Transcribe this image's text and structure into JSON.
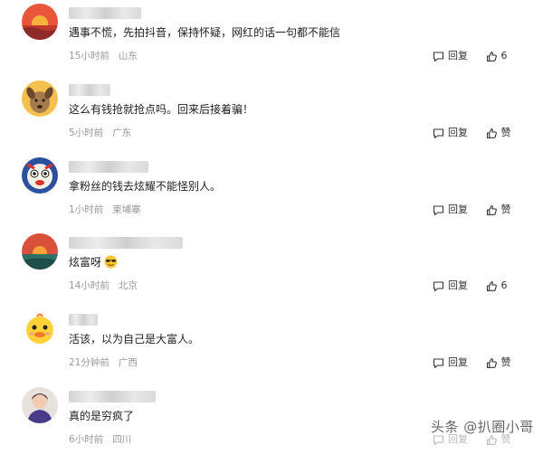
{
  "actions": {
    "reply_label": "回复",
    "like_label": "赞"
  },
  "comments": [
    {
      "avatar": "sunset-avatar",
      "text": "遇事不慌，先拍抖音，保持怀疑，网红的话一句都不能信",
      "time": "15小时前",
      "location": "山东",
      "likes": "6"
    },
    {
      "avatar": "dog-avatar",
      "text": "这么有钱抢就抢点吗。回来后接着骗！",
      "time": "5小时前",
      "location": "广东",
      "likes": "赞"
    },
    {
      "avatar": "cartoon-face-avatar",
      "text": "拿粉丝的钱去炫耀不能怪别人。",
      "time": "1小时前",
      "location": "柬埔寨",
      "likes": "赞"
    },
    {
      "avatar": "sunset-lake-avatar",
      "text": "炫富呀",
      "time": "14小时前",
      "location": "北京",
      "likes": "6"
    },
    {
      "avatar": "yellow-chick-avatar",
      "text": "活该，以为自己是大富人。",
      "time": "21分钟前",
      "location": "广西",
      "likes": "赞"
    },
    {
      "avatar": "person-photo-avatar",
      "text": "真的是穷疯了",
      "time": "6小时前",
      "location": "四川",
      "likes": "赞"
    }
  ],
  "watermark": "头条 @扒圈小哥"
}
